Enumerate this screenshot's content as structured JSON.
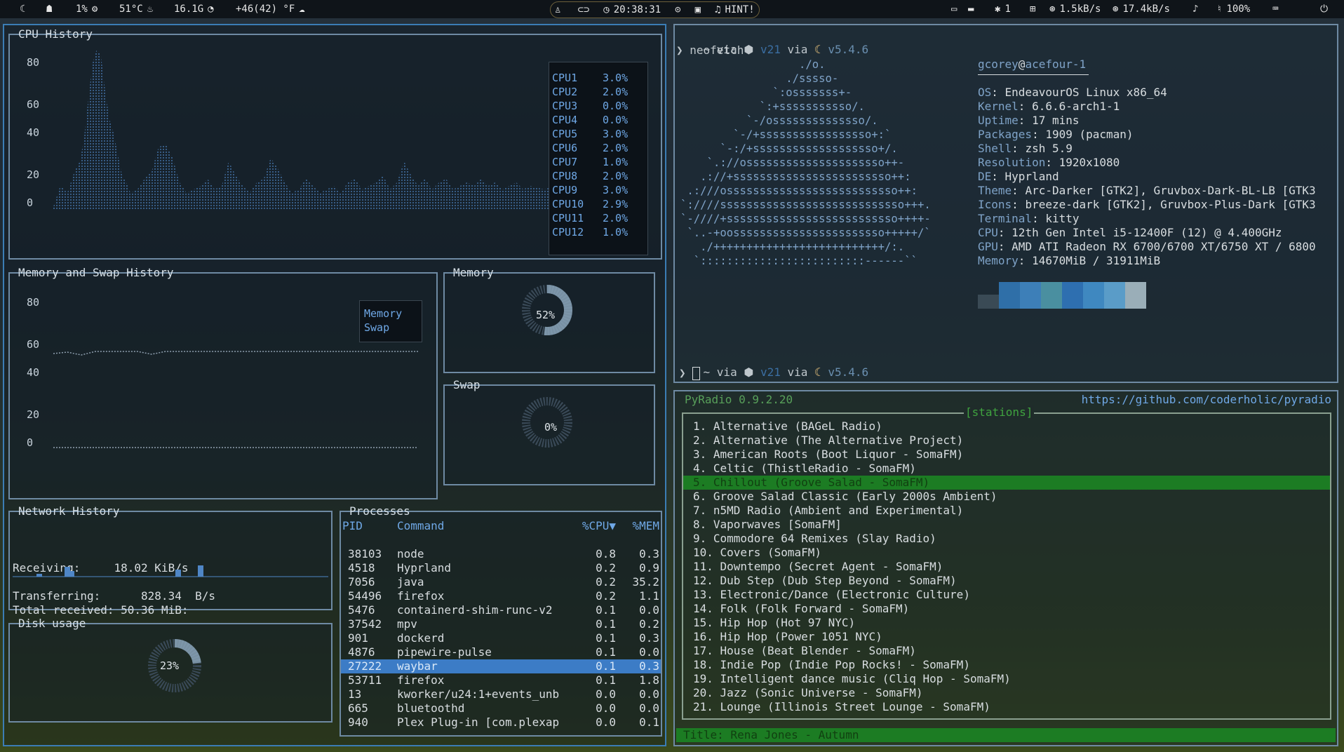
{
  "topbar": {
    "cpu": "1%",
    "temp": "51°C",
    "mem": "16.1G",
    "weather": "+46(42) °F",
    "clock": "20:38:31",
    "hint": "HINT!",
    "bluetooth": "1",
    "down": "1.5kB/s",
    "up": "17.4kB/s",
    "volume": "100%"
  },
  "cpu_history": {
    "title": "CPU History",
    "yticks": [
      "80",
      "60",
      "40",
      "20",
      "0"
    ],
    "cores": [
      {
        "name": "CPU1",
        "value": "3.0%"
      },
      {
        "name": "CPU2",
        "value": "2.0%"
      },
      {
        "name": "CPU3",
        "value": "0.0%"
      },
      {
        "name": "CPU4",
        "value": "0.0%"
      },
      {
        "name": "CPU5",
        "value": "3.0%"
      },
      {
        "name": "CPU6",
        "value": "2.0%"
      },
      {
        "name": "CPU7",
        "value": "1.0%"
      },
      {
        "name": "CPU8",
        "value": "2.0%"
      },
      {
        "name": "CPU9",
        "value": "3.0%"
      },
      {
        "name": "CPU10",
        "value": "2.9%"
      },
      {
        "name": "CPU11",
        "value": "2.0%"
      },
      {
        "name": "CPU12",
        "value": "1.0%"
      }
    ]
  },
  "mem_history": {
    "title": "Memory and Swap History",
    "yticks": [
      "80",
      "60",
      "40",
      "20",
      "0"
    ],
    "legend_memory": "Memory",
    "legend_swap": "Swap"
  },
  "memory": {
    "title": "Memory",
    "percent": "52%"
  },
  "swap": {
    "title": "Swap",
    "percent": "0%"
  },
  "network": {
    "title": "Network History",
    "receiving_label": "Receiving:",
    "receiving_value": "18.02 KiB/s",
    "total_label": "Total received:",
    "total_value": "50.36 MiB:",
    "transferring_label": "Transferring:",
    "transferring_value": "828.34  B/s"
  },
  "disk": {
    "title": "Disk usage",
    "percent": "23%"
  },
  "processes": {
    "title": "Processes",
    "headers": {
      "pid": "PID",
      "command": "Command",
      "cpu": "%CPU▼",
      "mem": "%MEM"
    },
    "rows": [
      {
        "pid": "38103",
        "command": "node",
        "cpu": "0.8",
        "mem": "0.3"
      },
      {
        "pid": "4518",
        "command": "Hyprland",
        "cpu": "0.2",
        "mem": "0.9"
      },
      {
        "pid": "7056",
        "command": "java",
        "cpu": "0.2",
        "mem": "35.2"
      },
      {
        "pid": "54496",
        "command": "firefox",
        "cpu": "0.2",
        "mem": "1.1"
      },
      {
        "pid": "5476",
        "command": "containerd-shim-runc-v2",
        "cpu": "0.1",
        "mem": "0.0"
      },
      {
        "pid": "37542",
        "command": "mpv",
        "cpu": "0.1",
        "mem": "0.2"
      },
      {
        "pid": "901",
        "command": "dockerd",
        "cpu": "0.1",
        "mem": "0.3"
      },
      {
        "pid": "4876",
        "command": "pipewire-pulse",
        "cpu": "0.1",
        "mem": "0.0"
      },
      {
        "pid": "27222",
        "command": "waybar",
        "cpu": "0.1",
        "mem": "0.3"
      },
      {
        "pid": "53711",
        "command": "firefox",
        "cpu": "0.1",
        "mem": "1.8"
      },
      {
        "pid": "13",
        "command": "kworker/u24:1+events_unb",
        "cpu": "0.0",
        "mem": "0.0"
      },
      {
        "pid": "665",
        "command": "bluetoothd",
        "cpu": "0.0",
        "mem": "0.0"
      },
      {
        "pid": "940",
        "command": "Plex Plug-in [com.plexap",
        "cpu": "0.0",
        "mem": "0.1"
      }
    ],
    "selected_index": 8
  },
  "neofetch": {
    "prompt_via1": "~ via",
    "prompt_v21": "v21",
    "prompt_via2": "via",
    "prompt_ver": "v5.4.6",
    "command": "neofetch",
    "user": "gcorey",
    "host": "acefour-1",
    "logo": [
      "                  ./o.",
      "                ./sssso-",
      "              `:osssssss+-",
      "            `:+sssssssssso/.",
      "          `-/ossssssssssssso/.",
      "        `-/+sssssssssssssssso+:`",
      "      `-:/+sssssssssssssssssso+/.",
      "    `.://osssssssssssssssssssso++-",
      "   .://+ssssssssssssssssssssssso++:",
      " .:///ossssssssssssssssssssssssso++:",
      "`:////ssssssssssssssssssssssssssso+++.",
      "`-////+ssssssssssssssssssssssssso++++-",
      " `..-+oosssssssssssssssssssssso+++++/`",
      "   ./++++++++++++++++++++++++++/:.",
      "  `:::::::::::::::::::::::::------``"
    ],
    "info": [
      {
        "k": "OS",
        "v": "EndeavourOS Linux x86_64"
      },
      {
        "k": "Kernel",
        "v": "6.6.6-arch1-1"
      },
      {
        "k": "Uptime",
        "v": "17 mins"
      },
      {
        "k": "Packages",
        "v": "1909 (pacman)"
      },
      {
        "k": "Shell",
        "v": "zsh 5.9"
      },
      {
        "k": "Resolution",
        "v": "1920x1080"
      },
      {
        "k": "DE",
        "v": "Hyprland"
      },
      {
        "k": "Theme",
        "v": "Arc-Darker [GTK2], Gruvbox-Dark-BL-LB [GTK3"
      },
      {
        "k": "Icons",
        "v": "breeze-dark [GTK2], Gruvbox-Plus-Dark [GTK3"
      },
      {
        "k": "Terminal",
        "v": "kitty"
      },
      {
        "k": "CPU",
        "v": "12th Gen Intel i5-12400F (12) @ 4.400GHz"
      },
      {
        "k": "GPU",
        "v": "AMD ATI Radeon RX 6700/6700 XT/6750 XT / 6800"
      },
      {
        "k": "Memory",
        "v": "14670MiB / 31911MiB"
      }
    ],
    "palette": [
      "#3a4a55",
      "#2f6fa8",
      "#3d7fb8",
      "#4a8fa0",
      "#2e6fb0",
      "#3f88c0",
      "#5a9cc8",
      "#9aaeb8"
    ]
  },
  "pyradio": {
    "title": "PyRadio 0.9.2.20",
    "url": "https://github.com/coderholic/pyradio",
    "section": "[stations]",
    "selected_index": 4,
    "stations": [
      "1. Alternative (BAGeL Radio)",
      "2. Alternative (The Alternative Project)",
      "3. American Roots (Boot Liquor - SomaFM)",
      "4. Celtic (ThistleRadio - SomaFM)",
      "5. Chillout (Groove Salad - SomaFM)",
      "6. Groove Salad Classic (Early 2000s Ambient)",
      "7. n5MD Radio (Ambient and Experimental)",
      "8. Vaporwaves [SomaFM]",
      "9. Commodore 64 Remixes (Slay Radio)",
      "10. Covers (SomaFM)",
      "11. Downtempo (Secret Agent - SomaFM)",
      "12. Dub Step (Dub Step Beyond - SomaFM)",
      "13. Electronic/Dance (Electronic Culture)",
      "14. Folk (Folk Forward - SomaFM)",
      "15. Hip Hop (Hot 97 NYC)",
      "16. Hip Hop (Power 1051 NYC)",
      "17. House (Beat Blender - SomaFM)",
      "18. Indie Pop (Indie Pop Rocks! - SomaFM)",
      "19. Intelligent dance music (Cliq Hop - SomaFM)",
      "20. Jazz (Sonic Universe - SomaFM)",
      "21. Lounge (Illinois Street Lounge - SomaFM)"
    ],
    "now_playing": "Title: Rena Jones - Autumn"
  }
}
